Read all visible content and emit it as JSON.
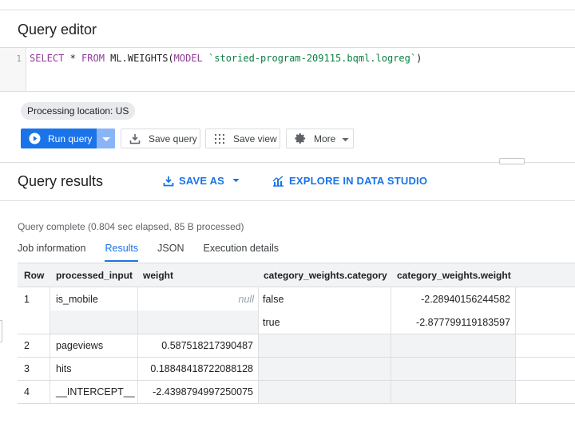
{
  "editor": {
    "title": "Query editor",
    "line_number": "1",
    "sql": {
      "select": "SELECT",
      "star": " * ",
      "from": "FROM",
      "func": " ML.WEIGHTS(",
      "model": "MODEL",
      "space": " ",
      "model_name": "`storied-program-209115.bqml.logreg`",
      "close": ")"
    },
    "processing_location": "Processing location: US"
  },
  "toolbar": {
    "run_label": "Run query",
    "save_query_label": "Save query",
    "save_view_label": "Save view",
    "more_label": "More"
  },
  "results": {
    "title": "Query results",
    "save_as_label": "SAVE AS",
    "explore_label": "EXPLORE IN DATA STUDIO",
    "status": "Query complete (0.804 sec elapsed, 85 B processed)",
    "tabs": [
      "Job information",
      "Results",
      "JSON",
      "Execution details"
    ],
    "active_tab": "Results",
    "columns": [
      "Row",
      "processed_input",
      "weight",
      "category_weights.category",
      "category_weights.weight"
    ],
    "rows": [
      {
        "row": "1",
        "input": "is_mobile",
        "weight": "null",
        "cats": [
          {
            "category": "false",
            "weight": "-2.28940156244582"
          },
          {
            "category": "true",
            "weight": "-2.877799119183597"
          }
        ]
      },
      {
        "row": "2",
        "input": "pageviews",
        "weight": "0.587518217390487"
      },
      {
        "row": "3",
        "input": "hits",
        "weight": "0.18848418722088128"
      },
      {
        "row": "4",
        "input": "__INTERCEPT__",
        "weight": "-2.4398794997250075"
      }
    ]
  },
  "icons": {
    "run": "play-circle-icon",
    "dropdown": "caret-down-icon",
    "save_query": "download-icon",
    "save_view": "grid-dots-icon",
    "more": "gear-icon",
    "save_as": "download-icon",
    "explore": "chart-icon"
  },
  "colors": {
    "accent": "#1a73e8",
    "run_dropdown": "#8ab4f8",
    "header_bg": "#f1f3f4"
  }
}
